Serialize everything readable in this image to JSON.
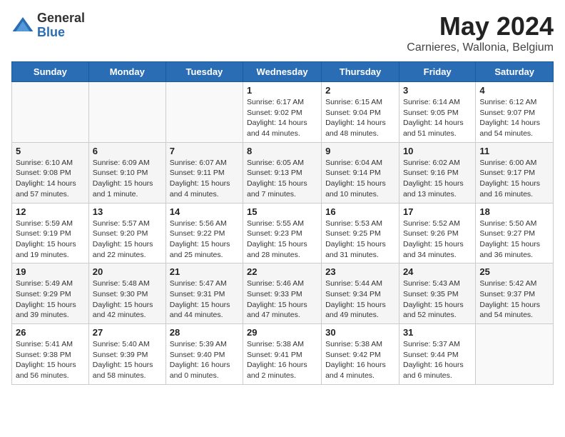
{
  "header": {
    "logo_general": "General",
    "logo_blue": "Blue",
    "title": "May 2024",
    "subtitle": "Carnieres, Wallonia, Belgium"
  },
  "weekdays": [
    "Sunday",
    "Monday",
    "Tuesday",
    "Wednesday",
    "Thursday",
    "Friday",
    "Saturday"
  ],
  "weeks": [
    [
      {
        "day": "",
        "sunrise": "",
        "sunset": "",
        "daylight": ""
      },
      {
        "day": "",
        "sunrise": "",
        "sunset": "",
        "daylight": ""
      },
      {
        "day": "",
        "sunrise": "",
        "sunset": "",
        "daylight": ""
      },
      {
        "day": "1",
        "sunrise": "Sunrise: 6:17 AM",
        "sunset": "Sunset: 9:02 PM",
        "daylight": "Daylight: 14 hours and 44 minutes."
      },
      {
        "day": "2",
        "sunrise": "Sunrise: 6:15 AM",
        "sunset": "Sunset: 9:04 PM",
        "daylight": "Daylight: 14 hours and 48 minutes."
      },
      {
        "day": "3",
        "sunrise": "Sunrise: 6:14 AM",
        "sunset": "Sunset: 9:05 PM",
        "daylight": "Daylight: 14 hours and 51 minutes."
      },
      {
        "day": "4",
        "sunrise": "Sunrise: 6:12 AM",
        "sunset": "Sunset: 9:07 PM",
        "daylight": "Daylight: 14 hours and 54 minutes."
      }
    ],
    [
      {
        "day": "5",
        "sunrise": "Sunrise: 6:10 AM",
        "sunset": "Sunset: 9:08 PM",
        "daylight": "Daylight: 14 hours and 57 minutes."
      },
      {
        "day": "6",
        "sunrise": "Sunrise: 6:09 AM",
        "sunset": "Sunset: 9:10 PM",
        "daylight": "Daylight: 15 hours and 1 minute."
      },
      {
        "day": "7",
        "sunrise": "Sunrise: 6:07 AM",
        "sunset": "Sunset: 9:11 PM",
        "daylight": "Daylight: 15 hours and 4 minutes."
      },
      {
        "day": "8",
        "sunrise": "Sunrise: 6:05 AM",
        "sunset": "Sunset: 9:13 PM",
        "daylight": "Daylight: 15 hours and 7 minutes."
      },
      {
        "day": "9",
        "sunrise": "Sunrise: 6:04 AM",
        "sunset": "Sunset: 9:14 PM",
        "daylight": "Daylight: 15 hours and 10 minutes."
      },
      {
        "day": "10",
        "sunrise": "Sunrise: 6:02 AM",
        "sunset": "Sunset: 9:16 PM",
        "daylight": "Daylight: 15 hours and 13 minutes."
      },
      {
        "day": "11",
        "sunrise": "Sunrise: 6:00 AM",
        "sunset": "Sunset: 9:17 PM",
        "daylight": "Daylight: 15 hours and 16 minutes."
      }
    ],
    [
      {
        "day": "12",
        "sunrise": "Sunrise: 5:59 AM",
        "sunset": "Sunset: 9:19 PM",
        "daylight": "Daylight: 15 hours and 19 minutes."
      },
      {
        "day": "13",
        "sunrise": "Sunrise: 5:57 AM",
        "sunset": "Sunset: 9:20 PM",
        "daylight": "Daylight: 15 hours and 22 minutes."
      },
      {
        "day": "14",
        "sunrise": "Sunrise: 5:56 AM",
        "sunset": "Sunset: 9:22 PM",
        "daylight": "Daylight: 15 hours and 25 minutes."
      },
      {
        "day": "15",
        "sunrise": "Sunrise: 5:55 AM",
        "sunset": "Sunset: 9:23 PM",
        "daylight": "Daylight: 15 hours and 28 minutes."
      },
      {
        "day": "16",
        "sunrise": "Sunrise: 5:53 AM",
        "sunset": "Sunset: 9:25 PM",
        "daylight": "Daylight: 15 hours and 31 minutes."
      },
      {
        "day": "17",
        "sunrise": "Sunrise: 5:52 AM",
        "sunset": "Sunset: 9:26 PM",
        "daylight": "Daylight: 15 hours and 34 minutes."
      },
      {
        "day": "18",
        "sunrise": "Sunrise: 5:50 AM",
        "sunset": "Sunset: 9:27 PM",
        "daylight": "Daylight: 15 hours and 36 minutes."
      }
    ],
    [
      {
        "day": "19",
        "sunrise": "Sunrise: 5:49 AM",
        "sunset": "Sunset: 9:29 PM",
        "daylight": "Daylight: 15 hours and 39 minutes."
      },
      {
        "day": "20",
        "sunrise": "Sunrise: 5:48 AM",
        "sunset": "Sunset: 9:30 PM",
        "daylight": "Daylight: 15 hours and 42 minutes."
      },
      {
        "day": "21",
        "sunrise": "Sunrise: 5:47 AM",
        "sunset": "Sunset: 9:31 PM",
        "daylight": "Daylight: 15 hours and 44 minutes."
      },
      {
        "day": "22",
        "sunrise": "Sunrise: 5:46 AM",
        "sunset": "Sunset: 9:33 PM",
        "daylight": "Daylight: 15 hours and 47 minutes."
      },
      {
        "day": "23",
        "sunrise": "Sunrise: 5:44 AM",
        "sunset": "Sunset: 9:34 PM",
        "daylight": "Daylight: 15 hours and 49 minutes."
      },
      {
        "day": "24",
        "sunrise": "Sunrise: 5:43 AM",
        "sunset": "Sunset: 9:35 PM",
        "daylight": "Daylight: 15 hours and 52 minutes."
      },
      {
        "day": "25",
        "sunrise": "Sunrise: 5:42 AM",
        "sunset": "Sunset: 9:37 PM",
        "daylight": "Daylight: 15 hours and 54 minutes."
      }
    ],
    [
      {
        "day": "26",
        "sunrise": "Sunrise: 5:41 AM",
        "sunset": "Sunset: 9:38 PM",
        "daylight": "Daylight: 15 hours and 56 minutes."
      },
      {
        "day": "27",
        "sunrise": "Sunrise: 5:40 AM",
        "sunset": "Sunset: 9:39 PM",
        "daylight": "Daylight: 15 hours and 58 minutes."
      },
      {
        "day": "28",
        "sunrise": "Sunrise: 5:39 AM",
        "sunset": "Sunset: 9:40 PM",
        "daylight": "Daylight: 16 hours and 0 minutes."
      },
      {
        "day": "29",
        "sunrise": "Sunrise: 5:38 AM",
        "sunset": "Sunset: 9:41 PM",
        "daylight": "Daylight: 16 hours and 2 minutes."
      },
      {
        "day": "30",
        "sunrise": "Sunrise: 5:38 AM",
        "sunset": "Sunset: 9:42 PM",
        "daylight": "Daylight: 16 hours and 4 minutes."
      },
      {
        "day": "31",
        "sunrise": "Sunrise: 5:37 AM",
        "sunset": "Sunset: 9:44 PM",
        "daylight": "Daylight: 16 hours and 6 minutes."
      },
      {
        "day": "",
        "sunrise": "",
        "sunset": "",
        "daylight": ""
      }
    ]
  ]
}
